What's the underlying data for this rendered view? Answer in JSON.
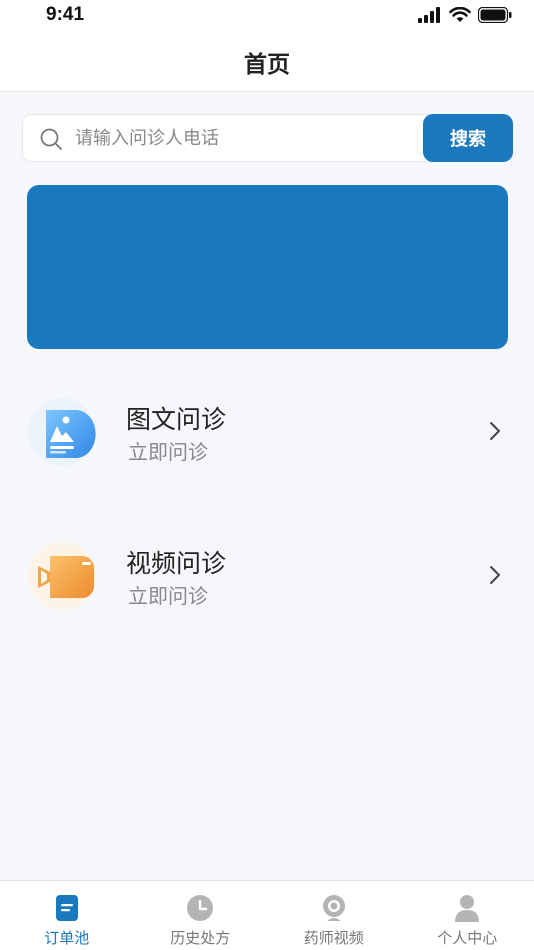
{
  "status_bar": {
    "time": "9:41"
  },
  "nav": {
    "title": "首页"
  },
  "search": {
    "placeholder": "请输入问诊人电话",
    "button_label": "搜索"
  },
  "services": [
    {
      "title": "图文问诊",
      "subtitle": "立即问诊",
      "icon": "image-text-icon"
    },
    {
      "title": "视频问诊",
      "subtitle": "立即问诊",
      "icon": "video-camera-icon"
    }
  ],
  "tabs": [
    {
      "label": "订单池",
      "icon": "order-pool-icon",
      "active": true
    },
    {
      "label": "历史处方",
      "icon": "clock-icon",
      "active": false
    },
    {
      "label": "药师视频",
      "icon": "webcam-icon",
      "active": false
    },
    {
      "label": "个人中心",
      "icon": "user-icon",
      "active": false
    }
  ],
  "colors": {
    "accent": "#1a78bf",
    "video_orange": "#f0a040",
    "inactive_icon": "#b4b4b4"
  }
}
